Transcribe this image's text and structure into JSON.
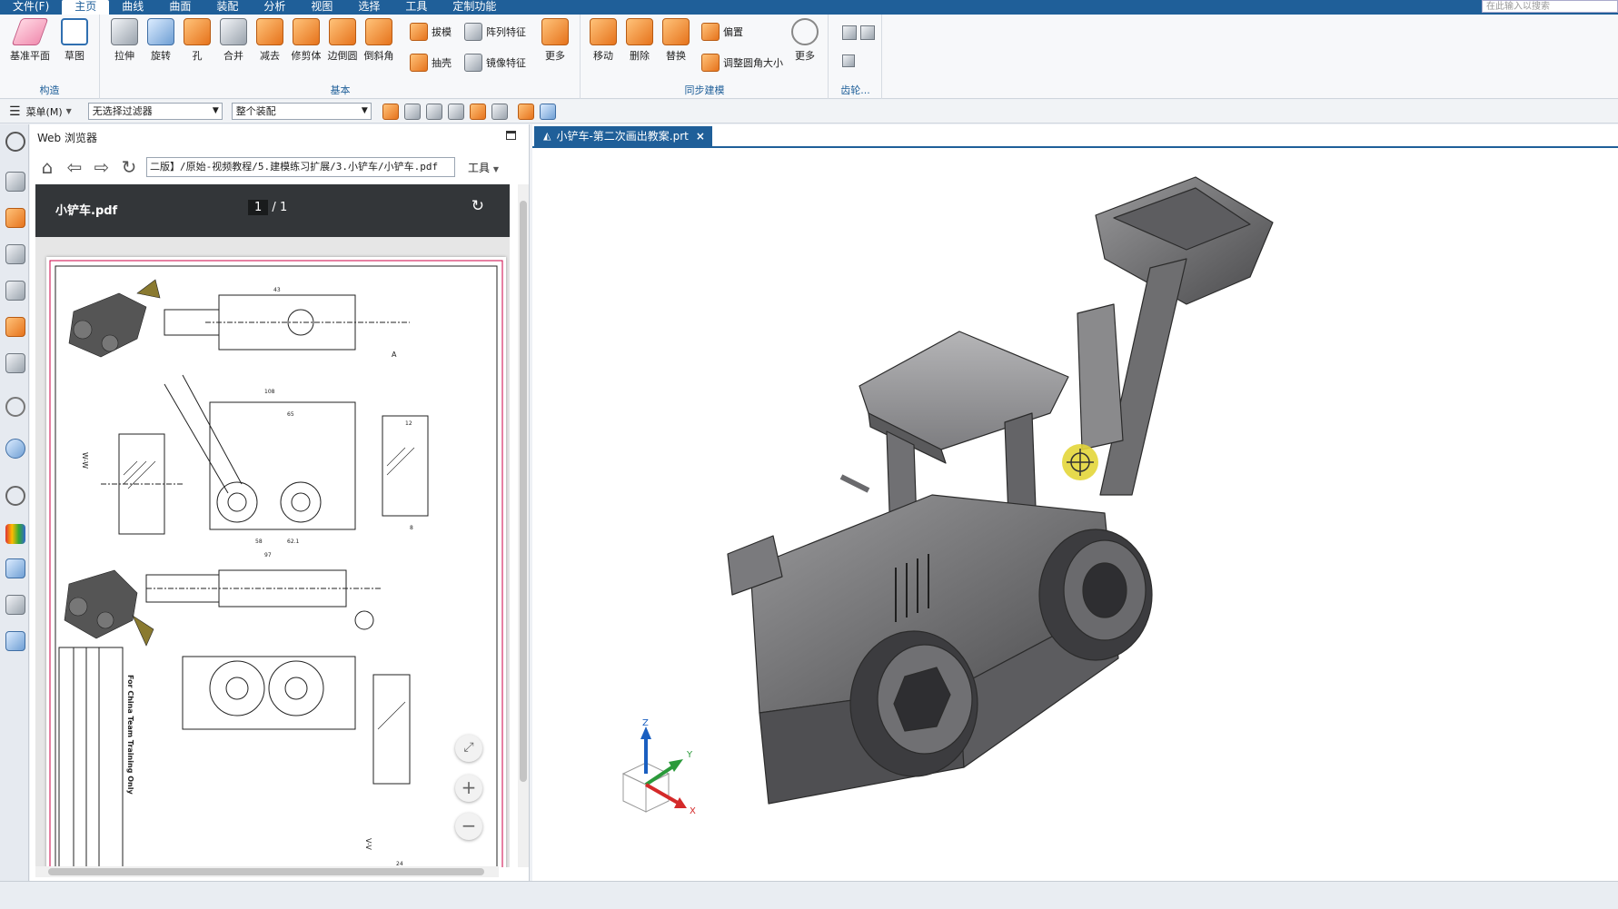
{
  "menubar": {
    "items": [
      "文件(F)",
      "主页",
      "曲线",
      "曲面",
      "装配",
      "分析",
      "视图",
      "选择",
      "工具",
      "定制功能"
    ],
    "active_index": 1,
    "search_placeholder": "在此输入以搜索"
  },
  "ribbon": {
    "groups": {
      "construct": {
        "label": "构造",
        "buttons": [
          {
            "label": "基准平面",
            "icon": "datum-plane-icon"
          },
          {
            "label": "草图",
            "icon": "sketch-icon"
          }
        ]
      },
      "basic": {
        "label": "基本",
        "big_buttons": [
          {
            "label": "拉伸",
            "icon": "extrude-icon"
          },
          {
            "label": "旋转",
            "icon": "revolve-icon"
          },
          {
            "label": "孔",
            "icon": "hole-icon"
          },
          {
            "label": "合并",
            "icon": "unite-icon"
          },
          {
            "label": "减去",
            "icon": "subtract-icon"
          },
          {
            "label": "修剪体",
            "icon": "trim-body-icon"
          },
          {
            "label": "边倒圆",
            "icon": "edge-blend-icon"
          },
          {
            "label": "倒斜角",
            "icon": "chamfer-icon"
          }
        ],
        "small_buttons": [
          {
            "label": "拔模",
            "icon": "draft-icon"
          },
          {
            "label": "阵列特征",
            "icon": "pattern-feature-icon"
          },
          {
            "label": "抽壳",
            "icon": "shell-icon"
          },
          {
            "label": "镜像特征",
            "icon": "mirror-feature-icon"
          }
        ],
        "more_label": "更多"
      },
      "sync": {
        "label": "同步建模",
        "big_buttons": [
          {
            "label": "移动",
            "icon": "move-face-icon"
          },
          {
            "label": "删除",
            "icon": "delete-face-icon"
          },
          {
            "label": "替换",
            "icon": "replace-face-icon"
          }
        ],
        "small_buttons": [
          {
            "label": "偏置",
            "icon": "offset-face-icon"
          },
          {
            "label": "调整圆角大小",
            "icon": "resize-blend-icon"
          }
        ],
        "more_label": "更多"
      },
      "gear": {
        "label": "齿轮..."
      }
    }
  },
  "filterbar": {
    "menu_label": "菜单(M)",
    "type_filter": "无选择过滤器",
    "scope_filter": "整个装配"
  },
  "webpanel": {
    "title": "Web 浏览器",
    "url": "二版】/原始-视频教程/5.建模练习扩展/3.小铲车/小铲车.pdf",
    "tools_label": "工具",
    "pdf": {
      "file_name": "小铲车.pdf",
      "current_page": "1",
      "page_separator": "/",
      "total_pages": "1"
    },
    "drawing_title_block": {
      "watermark": "For China Team Training Only",
      "view_labels": [
        "W-W",
        "V-V",
        "A"
      ]
    }
  },
  "viewport": {
    "tab_title": "小铲车-第二次画出教案.prt",
    "triad": {
      "x": "X",
      "y": "Y",
      "z": "Z"
    }
  },
  "colors": {
    "brand": "#1f5f99",
    "icon_orange": "#e6731c",
    "model_gray": "#6e6e70",
    "cursor_yellow": "#e3d63a"
  }
}
